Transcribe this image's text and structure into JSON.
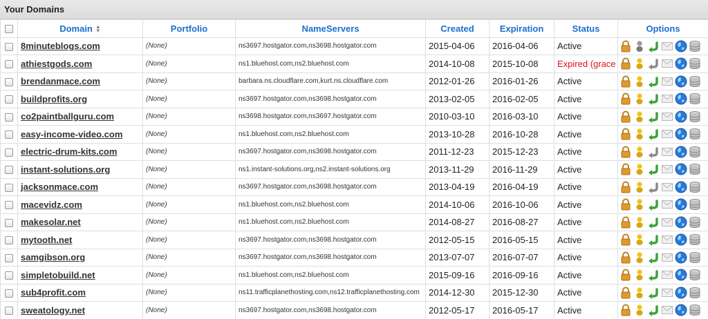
{
  "title": "Your Domains",
  "columns": {
    "domain": "Domain",
    "portfolio": "Portfolio",
    "nameservers": "NameServers",
    "created": "Created",
    "expiration": "Expiration",
    "status": "Status",
    "options": "Options"
  },
  "colors": {
    "header_text": "#1a6fd0",
    "expired": "#e0101a",
    "lock": "#e09a2a",
    "person": "#f2c21b",
    "arrow_green": "#3aa43a",
    "globe": "#2a79d8"
  },
  "rows": [
    {
      "domain": "8minuteblogs.com",
      "portfolio": "(None)",
      "nameservers": "ns3697.hostgator.com,ns3698.hostgator.com",
      "created": "2015-04-06",
      "expiration": "2016-04-06",
      "status": "Active",
      "expired": false,
      "person": "gray",
      "arrow": "green"
    },
    {
      "domain": "athiestgods.com",
      "portfolio": "(None)",
      "nameservers": "ns1.bluehost.com,ns2.bluehost.com",
      "created": "2014-10-08",
      "expiration": "2015-10-08",
      "status": "Expired (grace p",
      "expired": true,
      "person": "yellow",
      "arrow": "gray"
    },
    {
      "domain": "brendanmace.com",
      "portfolio": "(None)",
      "nameservers": "barbara.ns.cloudflare.com,kurt.ns.cloudflare.com",
      "created": "2012-01-26",
      "expiration": "2016-01-26",
      "status": "Active",
      "expired": false,
      "person": "yellow",
      "arrow": "green"
    },
    {
      "domain": "buildprofits.org",
      "portfolio": "(None)",
      "nameservers": "ns3697.hostgator.com,ns3698.hostgator.com",
      "created": "2013-02-05",
      "expiration": "2016-02-05",
      "status": "Active",
      "expired": false,
      "person": "yellow",
      "arrow": "green"
    },
    {
      "domain": "co2paintballguru.com",
      "portfolio": "(None)",
      "nameservers": "ns3698.hostgator.com,ns3697.hostgator.com",
      "created": "2010-03-10",
      "expiration": "2016-03-10",
      "status": "Active",
      "expired": false,
      "person": "yellow",
      "arrow": "green"
    },
    {
      "domain": "easy-income-video.com",
      "portfolio": "(None)",
      "nameservers": "ns1.bluehost.com,ns2.bluehost.com",
      "created": "2013-10-28",
      "expiration": "2016-10-28",
      "status": "Active",
      "expired": false,
      "person": "yellow",
      "arrow": "green"
    },
    {
      "domain": "electric-drum-kits.com",
      "portfolio": "(None)",
      "nameservers": "ns3697.hostgator.com,ns3698.hostgator.com",
      "created": "2011-12-23",
      "expiration": "2015-12-23",
      "status": "Active",
      "expired": false,
      "person": "yellow",
      "arrow": "gray"
    },
    {
      "domain": "instant-solutions.org",
      "portfolio": "(None)",
      "nameservers": "ns1.instant-solutions.org,ns2.instant-solutions.org",
      "created": "2013-11-29",
      "expiration": "2016-11-29",
      "status": "Active",
      "expired": false,
      "person": "yellow",
      "arrow": "green"
    },
    {
      "domain": "jacksonmace.com",
      "portfolio": "(None)",
      "nameservers": "ns3697.hostgator.com,ns3698.hostgator.com",
      "created": "2013-04-19",
      "expiration": "2016-04-19",
      "status": "Active",
      "expired": false,
      "person": "yellow",
      "arrow": "gray"
    },
    {
      "domain": "macevidz.com",
      "portfolio": "(None)",
      "nameservers": "ns1.bluehost.com,ns2.bluehost.com",
      "created": "2014-10-06",
      "expiration": "2016-10-06",
      "status": "Active",
      "expired": false,
      "person": "yellow",
      "arrow": "green"
    },
    {
      "domain": "makesolar.net",
      "portfolio": "(None)",
      "nameservers": "ns1.bluehost.com,ns2.bluehost.com",
      "created": "2014-08-27",
      "expiration": "2016-08-27",
      "status": "Active",
      "expired": false,
      "person": "yellow",
      "arrow": "green"
    },
    {
      "domain": "mytooth.net",
      "portfolio": "(None)",
      "nameservers": "ns3697.hostgator.com,ns3698.hostgator.com",
      "created": "2012-05-15",
      "expiration": "2016-05-15",
      "status": "Active",
      "expired": false,
      "person": "yellow",
      "arrow": "green"
    },
    {
      "domain": "samgibson.org",
      "portfolio": "(None)",
      "nameservers": "ns3697.hostgator.com,ns3698.hostgator.com",
      "created": "2013-07-07",
      "expiration": "2016-07-07",
      "status": "Active",
      "expired": false,
      "person": "yellow",
      "arrow": "green"
    },
    {
      "domain": "simpletobuild.net",
      "portfolio": "(None)",
      "nameservers": "ns1.bluehost.com,ns2.bluehost.com",
      "created": "2015-09-16",
      "expiration": "2016-09-16",
      "status": "Active",
      "expired": false,
      "person": "yellow",
      "arrow": "green"
    },
    {
      "domain": "sub4profit.com",
      "portfolio": "(None)",
      "nameservers": "ns11.trafficplanethosting.com,ns12.trafficplanethosting.com",
      "created": "2014-12-30",
      "expiration": "2015-12-30",
      "status": "Active",
      "expired": false,
      "person": "yellow",
      "arrow": "green"
    },
    {
      "domain": "sweatology.net",
      "portfolio": "(None)",
      "nameservers": "ns3697.hostgator.com,ns3698.hostgator.com",
      "created": "2012-05-17",
      "expiration": "2016-05-17",
      "status": "Active",
      "expired": false,
      "person": "yellow",
      "arrow": "green"
    }
  ]
}
